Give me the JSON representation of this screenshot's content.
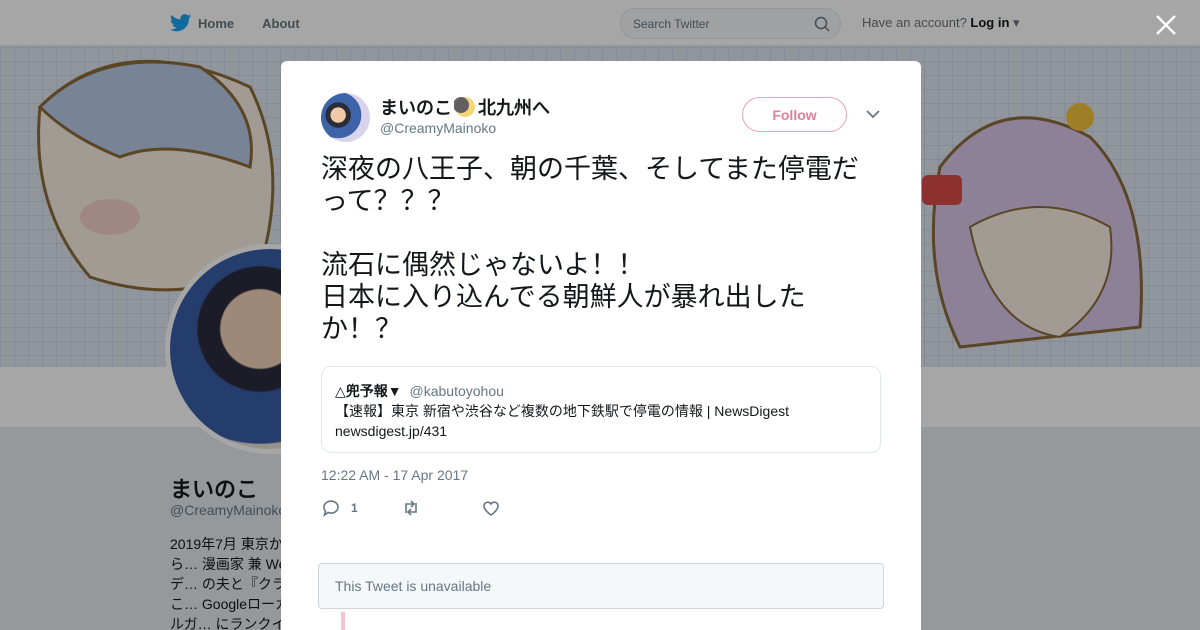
{
  "topbar": {
    "nav": [
      {
        "label": "Home",
        "icon": "twitter-bird-icon"
      },
      {
        "label": "About"
      }
    ],
    "search": {
      "placeholder": "Search Twitter"
    },
    "account_prompt": "Have an account?",
    "login_label": "Log in"
  },
  "profile": {
    "name": "まいのこ",
    "handle": "@CreamyMainoko",
    "bio": "2019年7月 東京から… 漫画家 兼 Webデ… の夫と『クラのこ… Googleローカルガ… にランクイン／ト…"
  },
  "tweet": {
    "author_name": "まいのこ",
    "author_name_suffix": "北九州へ",
    "author_handle": "@CreamyMainoko",
    "follow_label": "Follow",
    "text": "深夜の八王子、朝の千葉、そしてまた停電だって？？？\n\n流石に偶然じゃないよ！！\n日本に入り込んでる朝鮮人が暴れ出したか！？",
    "quote": {
      "author": "△兜予報▼",
      "handle": "@kabutoyohou",
      "line1": "【速報】東京 新宿や渋谷など複数の地下鉄駅で停電の情報 | NewsDigest",
      "line2": "newsdigest.jp/431"
    },
    "timestamp": "12:22 AM - 17 Apr 2017",
    "actions": {
      "reply_count": "1",
      "retweet_count": "",
      "like_count": ""
    },
    "unavailable_label": "This Tweet is unavailable"
  },
  "colors": {
    "twitter_blue": "#1da1f2",
    "follow_pink": "#e37d9c",
    "muted": "#657786"
  }
}
